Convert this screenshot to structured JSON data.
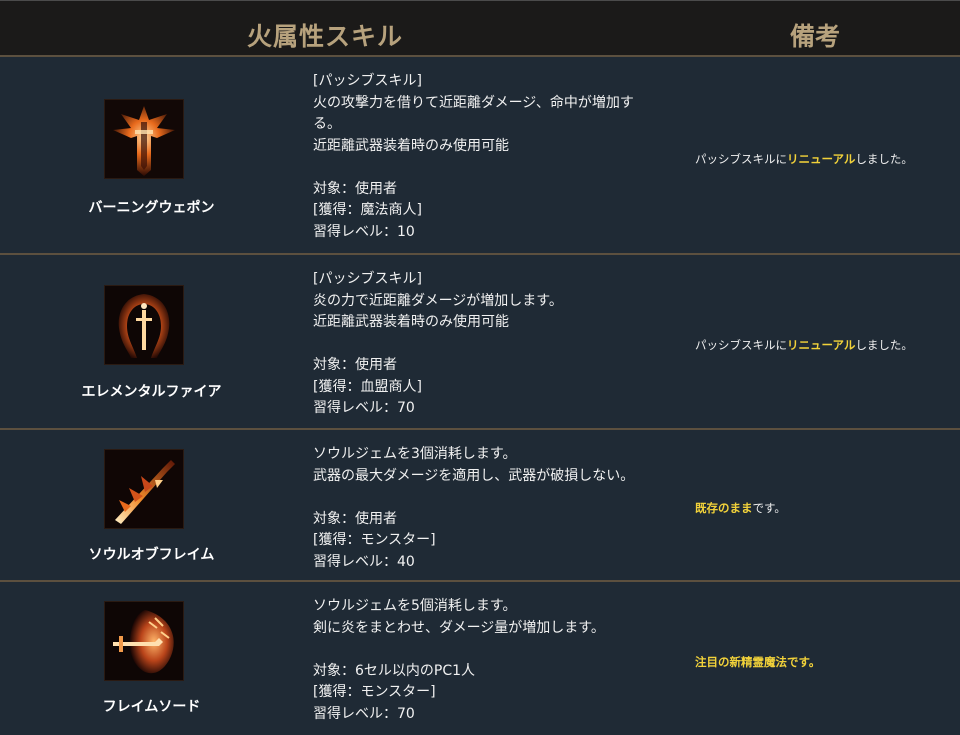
{
  "header": {
    "skill_col": "火属性スキル",
    "note_col": "備考"
  },
  "rows": [
    {
      "name": "バーニングウェポン",
      "icon": "burning-weapon-icon",
      "desc": "[パッシブスキル]\n火の攻撃力を借りて近距離ダメージ、命中が増加する。\n近距離武器装着時のみ使用可能\n\n対象：使用者\n[獲得：魔法商人]\n習得レベル：10",
      "note_pre": "パッシブスキルに",
      "note_hl": "リニューアル",
      "note_post": "しました。"
    },
    {
      "name": "エレメンタルファイア",
      "icon": "elemental-fire-icon",
      "desc": "[パッシブスキル]\n炎の力で近距離ダメージが増加します。\n近距離武器装着時のみ使用可能\n\n対象：使用者\n[獲得：血盟商人]\n習得レベル：70",
      "note_pre": "パッシブスキルに",
      "note_hl": "リニューアル",
      "note_post": "しました。"
    },
    {
      "name": "ソウルオブフレイム",
      "icon": "soul-of-flame-icon",
      "desc": "ソウルジェムを3個消耗します。\n武器の最大ダメージを適用し、武器が破損しない。\n\n対象：使用者\n[獲得：モンスター]\n習得レベル：40",
      "note_pre": "",
      "note_hl": "既存のまま",
      "note_post": "です。"
    },
    {
      "name": "フレイムソード",
      "icon": "flame-sword-icon",
      "desc": "ソウルジェムを5個消耗します。\n剣に炎をまとわせ、ダメージ量が増加します。\n\n対象：6セル以内のPC1人\n[獲得：モンスター]\n習得レベル：70",
      "note_pre": "",
      "note_hl": "注目の新精霊魔法です。",
      "note_post": ""
    }
  ],
  "colors": {
    "header_text": "#b7a27d",
    "highlight": "#f2d23a",
    "row_bg": "#1f2a35",
    "divider": "#5c503f"
  }
}
